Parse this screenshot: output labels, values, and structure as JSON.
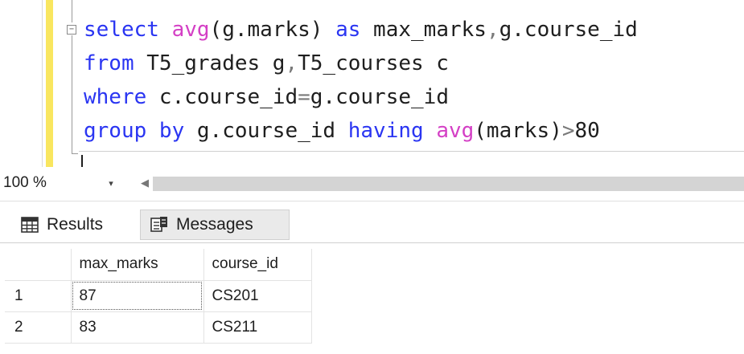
{
  "editor": {
    "outline_toggle": "−",
    "lines": [
      [
        {
          "t": "select",
          "c": "kw"
        },
        {
          "t": " "
        },
        {
          "t": "avg",
          "c": "fn"
        },
        {
          "t": "(g.marks) "
        },
        {
          "t": "as",
          "c": "kw"
        },
        {
          "t": " max_marks"
        },
        {
          "t": ",",
          "c": "op"
        },
        {
          "t": "g.course_id"
        }
      ],
      [
        {
          "t": "from",
          "c": "kw"
        },
        {
          "t": " T5_grades g"
        },
        {
          "t": ",",
          "c": "op"
        },
        {
          "t": "T5_courses c"
        }
      ],
      [
        {
          "t": "where",
          "c": "kw"
        },
        {
          "t": " c.course_id"
        },
        {
          "t": "=",
          "c": "op"
        },
        {
          "t": "g.course_id"
        }
      ],
      [
        {
          "t": "group by",
          "c": "kw"
        },
        {
          "t": " g.course_id "
        },
        {
          "t": "having",
          "c": "kw"
        },
        {
          "t": " "
        },
        {
          "t": "avg",
          "c": "fn"
        },
        {
          "t": "(marks)"
        },
        {
          "t": ">",
          "c": "op"
        },
        {
          "t": "80"
        }
      ]
    ]
  },
  "zoom": {
    "label": "100 %",
    "arrow": "▾",
    "scroll_left": "◀"
  },
  "tabs": {
    "results": {
      "label": "Results",
      "icon": "grid-icon"
    },
    "messages": {
      "label": "Messages",
      "icon": "messages-icon"
    }
  },
  "results_grid": {
    "columns": [
      "max_marks",
      "course_id"
    ],
    "rows": [
      {
        "num": "1",
        "max_marks": "87",
        "course_id": "CS201"
      },
      {
        "num": "2",
        "max_marks": "83",
        "course_id": "CS211"
      }
    ]
  }
}
